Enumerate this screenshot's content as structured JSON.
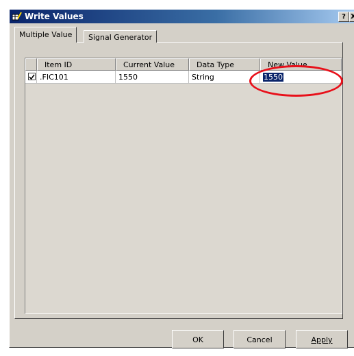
{
  "window": {
    "title": "Write Values",
    "help_label": "?",
    "close_label": "X"
  },
  "tabs": [
    {
      "label": "Multiple Value",
      "active": true
    },
    {
      "label": "Signal Generator",
      "active": false
    }
  ],
  "table": {
    "columns": [
      "Item ID",
      "Current Value",
      "Data Type",
      "New Value"
    ],
    "rows": [
      {
        "checked": true,
        "item_id": ".FIC101",
        "current_value": "1550",
        "data_type": "String",
        "new_value": "1550"
      }
    ]
  },
  "buttons": {
    "ok": "OK",
    "cancel": "Cancel",
    "apply": "Apply"
  },
  "colors": {
    "highlight_circle": "#e8101a",
    "selection": "#0a246a",
    "titlebar": "#0a246a"
  },
  "icons": {
    "title": "write-values-app-icon",
    "checkbox": "checkmark-icon"
  }
}
